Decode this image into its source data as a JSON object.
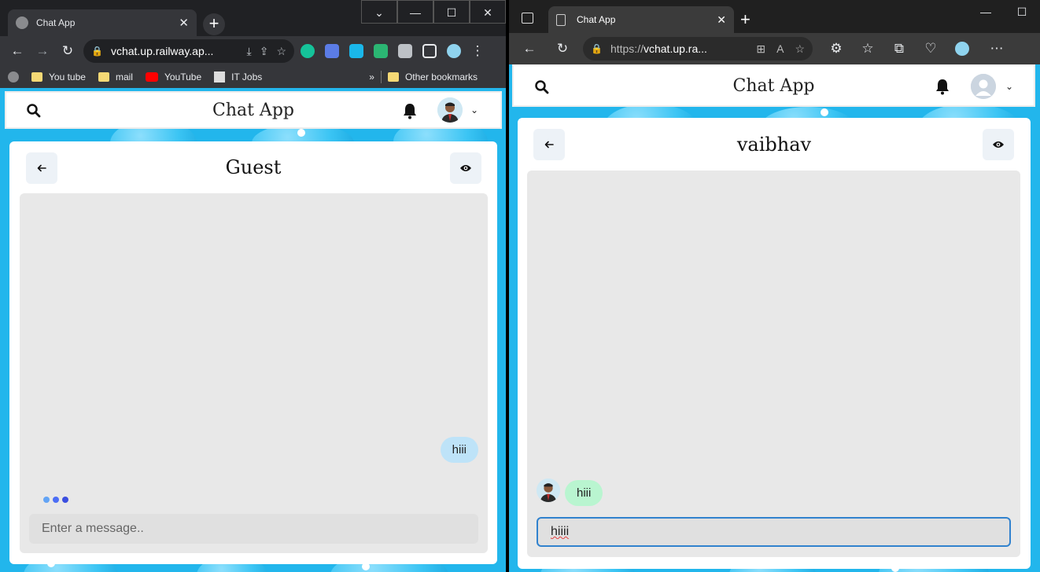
{
  "left_browser": {
    "tab_title": "Chat App",
    "url": "vchat.up.railway.ap...",
    "bookmarks": [
      "You tube",
      "mail",
      "YouTube",
      "IT Jobs"
    ],
    "other_bookmarks": "Other bookmarks",
    "more_bookmarks": "»"
  },
  "right_browser": {
    "tab_title": "Chat App",
    "url_prefix": "https://",
    "url_host": "vchat.up.ra..."
  },
  "left_app": {
    "title": "Chat App",
    "chat_name": "Guest",
    "messages": [
      {
        "from": "me",
        "text": "hiii"
      }
    ],
    "typing_indicator": true,
    "input_placeholder": "Enter a message..",
    "input_value": ""
  },
  "right_app": {
    "title": "Chat App",
    "chat_name": "vaibhav",
    "messages": [
      {
        "from": "them",
        "text": "hiii"
      }
    ],
    "input_value": "hiiii"
  },
  "colors": {
    "background_blue": "#22b6ec",
    "my_bubble": "#bee3f8",
    "their_bubble": "#b9f5d0",
    "input_focus_border": "#3182ce",
    "typing_dots": [
      "#63a4f5",
      "#4c6ef5",
      "#3b4fe0"
    ]
  },
  "icons": {
    "search": "search-icon",
    "bell": "bell-icon",
    "back": "arrow-left-icon",
    "eye": "eye-icon",
    "chevron": "chevron-down-icon"
  }
}
